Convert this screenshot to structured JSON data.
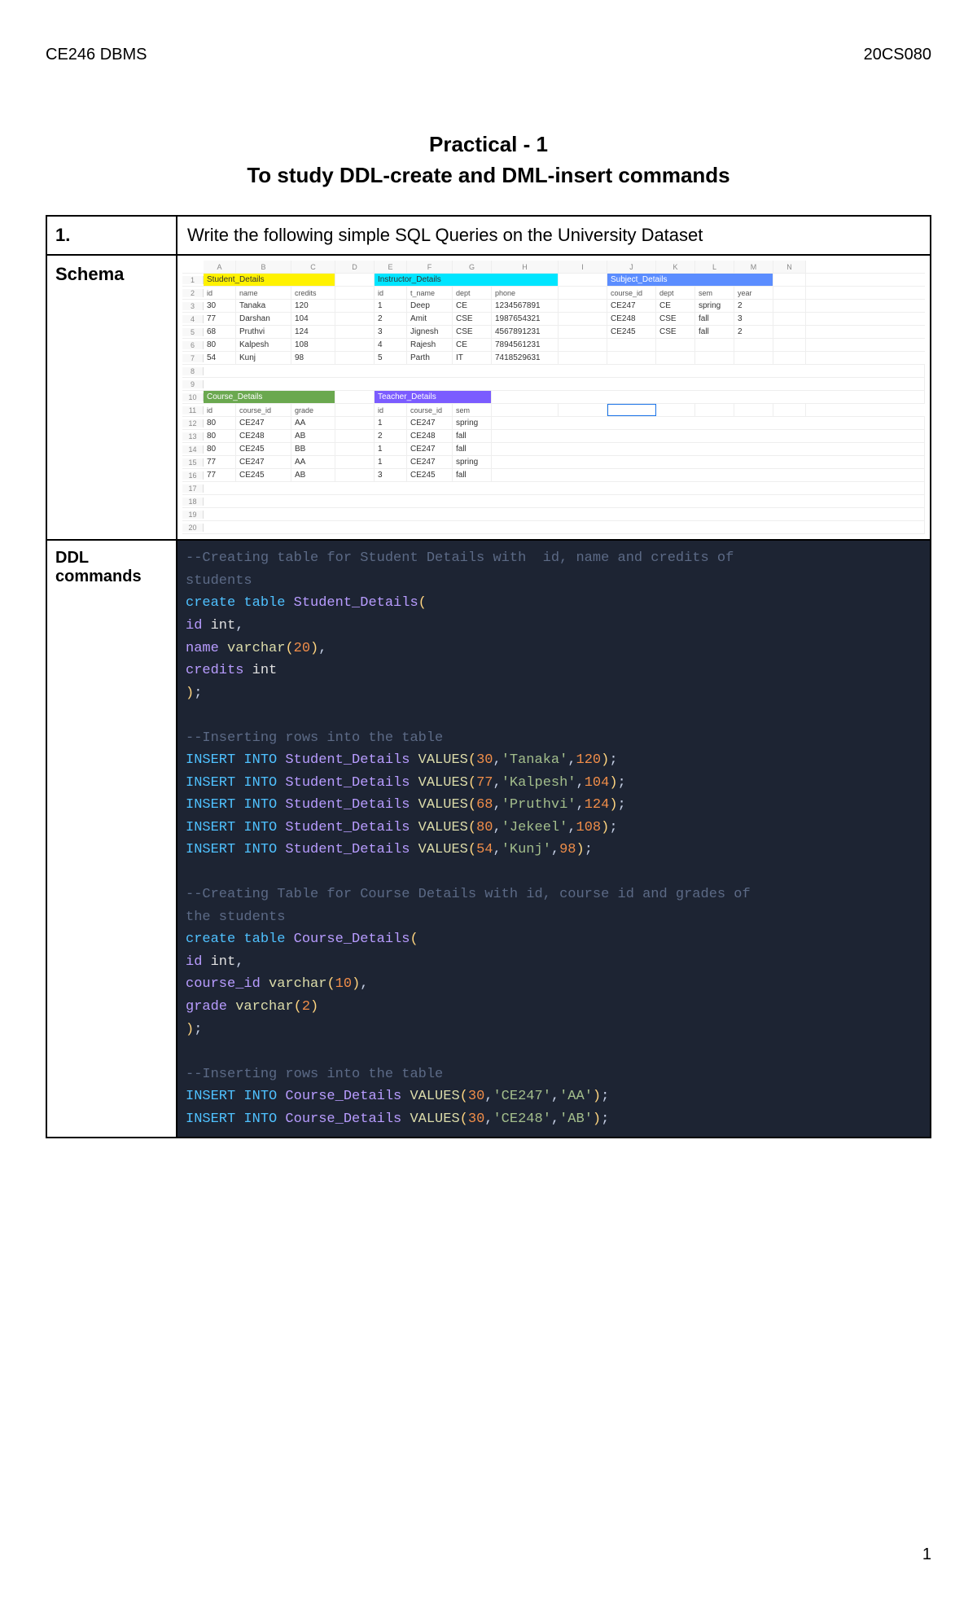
{
  "header": {
    "left": "CE246 DBMS",
    "right": "20CS080"
  },
  "title_line1": "Practical - 1",
  "title_line2": "To study DDL-create and DML-insert commands",
  "rows": {
    "num": "1.",
    "question": "Write the following simple SQL Queries on the University Dataset",
    "schema_label": "Schema",
    "ddl_label_l1": "DDL",
    "ddl_label_l2": "commands"
  },
  "sheet": {
    "cols": [
      "A",
      "B",
      "C",
      "D",
      "E",
      "F",
      "G",
      "H",
      "I",
      "J",
      "K",
      "L",
      "M",
      "N"
    ],
    "row_nums": [
      "1",
      "2",
      "3",
      "4",
      "5",
      "6",
      "7",
      "8",
      "9",
      "10",
      "11",
      "12",
      "13",
      "14",
      "15",
      "16",
      "17",
      "18",
      "19",
      "20"
    ],
    "student_header": "Student_Details",
    "instructor_header": "Instructor_Details",
    "subject_header": "Subject_Details",
    "course_header": "Course_Details",
    "teacher_header": "Teacher_Details",
    "student_cols": [
      "id",
      "name",
      "credits"
    ],
    "student_rows": [
      [
        "30",
        "Tanaka",
        "120"
      ],
      [
        "77",
        "Darshan",
        "104"
      ],
      [
        "68",
        "Pruthvi",
        "124"
      ],
      [
        "80",
        "Kalpesh",
        "108"
      ],
      [
        "54",
        "Kunj",
        "98"
      ]
    ],
    "instructor_cols": [
      "id",
      "t_name",
      "dept",
      "phone"
    ],
    "instructor_rows": [
      [
        "1",
        "Deep",
        "CE",
        "1234567891"
      ],
      [
        "2",
        "Amit",
        "CSE",
        "1987654321"
      ],
      [
        "3",
        "Jignesh",
        "CSE",
        "4567891231"
      ],
      [
        "4",
        "Rajesh",
        "CE",
        "7894561231"
      ],
      [
        "5",
        "Parth",
        "IT",
        "7418529631"
      ]
    ],
    "subject_cols": [
      "course_id",
      "dept",
      "sem",
      "year"
    ],
    "subject_rows": [
      [
        "CE247",
        "CE",
        "spring",
        "2"
      ],
      [
        "CE248",
        "CSE",
        "fall",
        "3"
      ],
      [
        "CE245",
        "CSE",
        "fall",
        "2"
      ]
    ],
    "course_cols": [
      "id",
      "course_id",
      "grade"
    ],
    "course_rows": [
      [
        "80",
        "CE247",
        "AA"
      ],
      [
        "80",
        "CE248",
        "AB"
      ],
      [
        "80",
        "CE245",
        "BB"
      ],
      [
        "77",
        "CE247",
        "AA"
      ],
      [
        "77",
        "CE245",
        "AB"
      ]
    ],
    "teacher_cols": [
      "id",
      "course_id",
      "sem"
    ],
    "teacher_rows": [
      [
        "1",
        "CE247",
        "spring"
      ],
      [
        "2",
        "CE248",
        "fall"
      ],
      [
        "1",
        "CE247",
        "fall"
      ],
      [
        "1",
        "CE247",
        "spring"
      ],
      [
        "3",
        "CE245",
        "fall"
      ]
    ]
  },
  "code": {
    "c1": "--Creating table for Student Details with  id, name and credits of",
    "c2": "students",
    "l3a": "create table",
    "l3b": "Student_Details",
    "l4a": "id",
    "l4b": "int",
    "l5a": "name",
    "l5b": "varchar",
    "l5c": "20",
    "l6a": "credits",
    "l6b": "int",
    "c7": "--Inserting rows into the table",
    "ins": "INSERT INTO",
    "sd": "Student_Details",
    "vals": "VALUES",
    "i1n": "30",
    "i1s": "'Tanaka'",
    "i1v": "120",
    "i2n": "77",
    "i2s": "'Kalpesh'",
    "i2v": "104",
    "i3n": "68",
    "i3s": "'Pruthvi'",
    "i3v": "124",
    "i4n": "80",
    "i4s": "'Jekeel'",
    "i4v": "108",
    "i5n": "54",
    "i5s": "'Kunj'",
    "i5v": "98",
    "c8a": "--Creating Table for Course Details with id, course id and grades of",
    "c8b": "the students",
    "cd": "Course_Details",
    "l9a": "course_id",
    "l9b": "varchar",
    "l9c": "10",
    "l10a": "grade",
    "l10b": "varchar",
    "l10c": "2",
    "ci1n": "30",
    "ci1s": "'CE247'",
    "ci1g": "'AA'",
    "ci2n": "30",
    "ci2s": "'CE248'",
    "ci2g": "'AB'"
  },
  "page_number": "1"
}
